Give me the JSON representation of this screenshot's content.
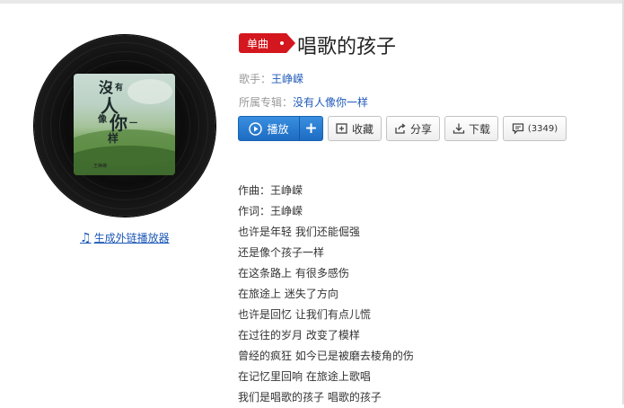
{
  "album_cover": {
    "title_glyphs": [
      "沒",
      "有",
      "人",
      "像",
      "你",
      "一",
      "样"
    ],
    "artist_tag": "王峥嵘"
  },
  "generate_link": "生成外链播放器",
  "song": {
    "badge": "单曲",
    "title": "唱歌的孩子",
    "singer_label": "歌手：",
    "singer": "王峥嵘",
    "album_label": "所属专辑：",
    "album": "没有人像你一样"
  },
  "actions": {
    "play": "播放",
    "add": "+",
    "collect": "收藏",
    "share": "分享",
    "download": "下载",
    "comment_count": "(3349)"
  },
  "lyrics": [
    "作曲：王峥嵘",
    "作词：王峥嵘",
    "也许是年轻 我们还能倔强",
    "还是像个孩子一样",
    "在这条路上 有很多感伤",
    "在旅途上 迷失了方向",
    "也许是回忆 让我们有点儿慌",
    "在过往的岁月 改变了模样",
    "曾经的疯狂 如今已是被磨去棱角的伤",
    "在记忆里回响 在旅途上歌唱",
    "我们是唱歌的孩子 唱歌的孩子"
  ],
  "colors": {
    "accent": "#d4171e",
    "link": "#1f5ab8",
    "play": "#2b7fd6"
  }
}
